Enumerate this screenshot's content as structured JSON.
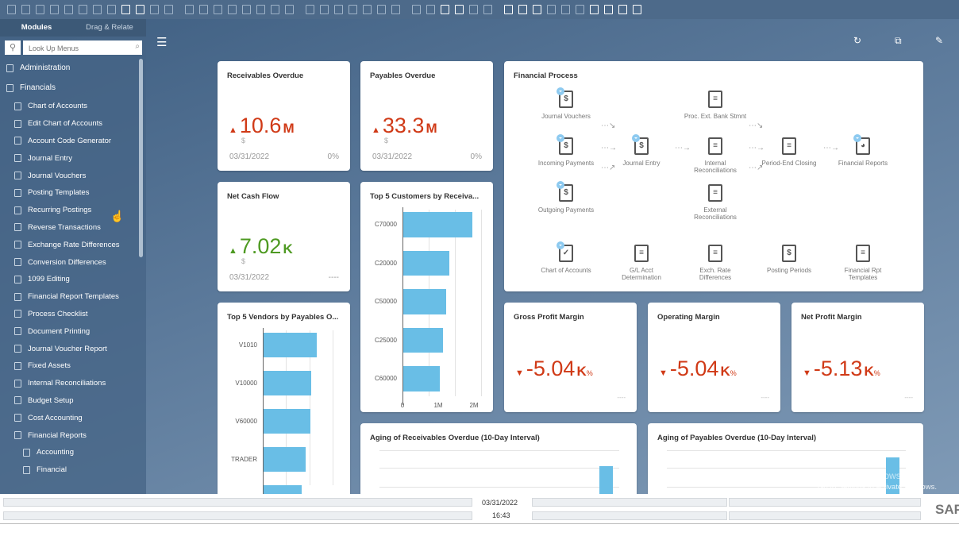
{
  "toolbar": {
    "icons": [
      "print-preview-icon",
      "print-icon",
      "export-icon",
      "email-icon",
      "fax-icon",
      "excel-icon",
      "word-icon",
      "pdf-icon",
      "move-icon",
      "lock-icon",
      "find-icon",
      "add-icon",
      "first-record-icon",
      "previous-record-icon",
      "next-record-icon",
      "last-record-icon",
      "refresh-icon",
      "filter-icon",
      "sort-icon",
      "base-document-icon",
      "target-document-icon",
      "layout-icon",
      "payment-means-icon",
      "gross-profit-icon",
      "volume-weight-icon",
      "journal-icon",
      "query-icon",
      "pencil-icon",
      "settings-icon",
      "messages-icon",
      "inbox-icon",
      "outbox-icon",
      "alerts-icon",
      "calendar-icon",
      "calculator-icon",
      "org-icon",
      "stamp-icon",
      "help-settings-icon",
      "grid-icon",
      "launch-icon",
      "edit-form-icon",
      "browser-icon",
      "help-icon"
    ]
  },
  "sidebar": {
    "tabs": [
      "Modules",
      "Drag & Relate"
    ],
    "search_placeholder": "Look Up Menus",
    "items": [
      {
        "label": "Administration",
        "level": 0
      },
      {
        "label": "Financials",
        "level": 0
      },
      {
        "label": "Chart of Accounts",
        "level": 1
      },
      {
        "label": "Edit Chart of Accounts",
        "level": 1
      },
      {
        "label": "Account Code Generator",
        "level": 1
      },
      {
        "label": "Journal Entry",
        "level": 1
      },
      {
        "label": "Journal Vouchers",
        "level": 1
      },
      {
        "label": "Posting Templates",
        "level": 1
      },
      {
        "label": "Recurring Postings",
        "level": 1
      },
      {
        "label": "Reverse Transactions",
        "level": 1
      },
      {
        "label": "Exchange Rate Differences",
        "level": 1
      },
      {
        "label": "Conversion Differences",
        "level": 1
      },
      {
        "label": "1099 Editing",
        "level": 1
      },
      {
        "label": "Financial Report Templates",
        "level": 1
      },
      {
        "label": "Process Checklist",
        "level": 1
      },
      {
        "label": "Document Printing",
        "level": 1
      },
      {
        "label": "Journal Voucher Report",
        "level": 1
      },
      {
        "label": "Fixed Assets",
        "level": 1
      },
      {
        "label": "Internal Reconciliations",
        "level": 1
      },
      {
        "label": "Budget Setup",
        "level": 1
      },
      {
        "label": "Cost Accounting",
        "level": 1
      },
      {
        "label": "Financial Reports",
        "level": 1
      },
      {
        "label": "Accounting",
        "level": 2
      },
      {
        "label": "Financial",
        "level": 2
      }
    ]
  },
  "kpis": {
    "receivables": {
      "title": "Receivables Overdue",
      "value": "10.6",
      "unit": "M",
      "currency": "$",
      "date": "03/31/2022",
      "change": "0%",
      "trend": "up",
      "color": "#d03a17"
    },
    "payables": {
      "title": "Payables Overdue",
      "value": "33.3",
      "unit": "M",
      "currency": "$",
      "date": "03/31/2022",
      "change": "0%",
      "trend": "up",
      "color": "#d03a17"
    },
    "netcash": {
      "title": "Net Cash Flow",
      "value": "7.02",
      "unit": "K",
      "currency": "$",
      "date": "03/31/2022",
      "change": "----",
      "trend": "up",
      "color": "#4e9a22"
    },
    "gross": {
      "title": "Gross Profit Margin",
      "value": "-5.04",
      "unit": "K",
      "pct": "%",
      "change": "----",
      "trend": "down"
    },
    "operating": {
      "title": "Operating Margin",
      "value": "-5.04",
      "unit": "K",
      "pct": "%",
      "change": "----",
      "trend": "down"
    },
    "net": {
      "title": "Net Profit Margin",
      "value": "-5.13",
      "unit": "K",
      "pct": "%",
      "change": "----",
      "trend": "down"
    }
  },
  "process": {
    "title": "Financial Process",
    "nodes": [
      {
        "label": "Journal Vouchers",
        "icon": "journal-vouchers-icon",
        "glyph": "$",
        "badge": true
      },
      {
        "label": "Incoming Payments",
        "icon": "incoming-payments-icon",
        "glyph": "$",
        "badge": true
      },
      {
        "label": "Outgoing Payments",
        "icon": "outgoing-payments-icon",
        "glyph": "$",
        "badge": true
      },
      {
        "label": "Journal Entry",
        "icon": "journal-entry-icon",
        "glyph": "$",
        "badge": true
      },
      {
        "label": "Proc. Ext. Bank Stmnt",
        "icon": "document-icon",
        "glyph": "≡",
        "badge": false
      },
      {
        "label": "Internal Reconciliations",
        "icon": "document-icon",
        "glyph": "≡",
        "badge": false
      },
      {
        "label": "External Reconciliations",
        "icon": "document-icon",
        "glyph": "≡",
        "badge": false
      },
      {
        "label": "Period-End Closing",
        "icon": "document-icon",
        "glyph": "≡",
        "badge": false
      },
      {
        "label": "Financial Reports",
        "icon": "pie-chart-icon",
        "glyph": "◕",
        "badge": true
      },
      {
        "label": "Chart of Accounts",
        "icon": "checklist-icon",
        "glyph": "✓",
        "badge": true
      },
      {
        "label": "G/L Acct Determination",
        "icon": "document-icon",
        "glyph": "≡",
        "badge": false
      },
      {
        "label": "Exch. Rate Differences",
        "icon": "document-icon",
        "glyph": "≡",
        "badge": false
      },
      {
        "label": "Posting Periods",
        "icon": "posting-periods-icon",
        "glyph": "$",
        "badge": false
      },
      {
        "label": "Financial Rpt Templates",
        "icon": "document-icon",
        "glyph": "≡",
        "badge": false
      }
    ]
  },
  "chart_data": [
    {
      "type": "bar",
      "orientation": "horizontal",
      "title": "Top 5 Customers by Receiva...",
      "categories": [
        "C70000",
        "C20000",
        "C50000",
        "C25000",
        "C60000"
      ],
      "values": [
        1930000,
        1290000,
        1200000,
        1110000,
        1020000
      ],
      "xlim": [
        0,
        2200000
      ],
      "xticks": [
        "0",
        "1M",
        "2M"
      ],
      "grid": true,
      "color": "#69bee6"
    },
    {
      "type": "bar",
      "orientation": "horizontal",
      "title": "Top 5 Vendors by Payables O...",
      "categories": [
        "V1010",
        "V10000",
        "V60000",
        "TRADER",
        ""
      ],
      "values": [
        2.3,
        2.05,
        2.0,
        1.8,
        1.65
      ],
      "grid": true,
      "color": "#69bee6"
    },
    {
      "type": "bar",
      "title": "Aging of Receivables Overdue (10-Day Interval)",
      "values": [
        0,
        0,
        0,
        0,
        0,
        0,
        0,
        0,
        0,
        0,
        0,
        1
      ],
      "grid": true,
      "color": "#69bee6"
    },
    {
      "type": "bar",
      "title": "Aging of Payables Overdue (10-Day Interval)",
      "values": [
        0,
        0,
        0,
        0,
        0,
        0,
        0,
        0,
        0,
        0,
        0,
        1
      ],
      "grid": true,
      "color": "#69bee6"
    }
  ],
  "status": {
    "date": "03/31/2022",
    "time": "16:43"
  },
  "watermark": {
    "line1": "Activate Windows",
    "line2": "Go to Settings to activate Windows."
  },
  "brand": "SAP"
}
